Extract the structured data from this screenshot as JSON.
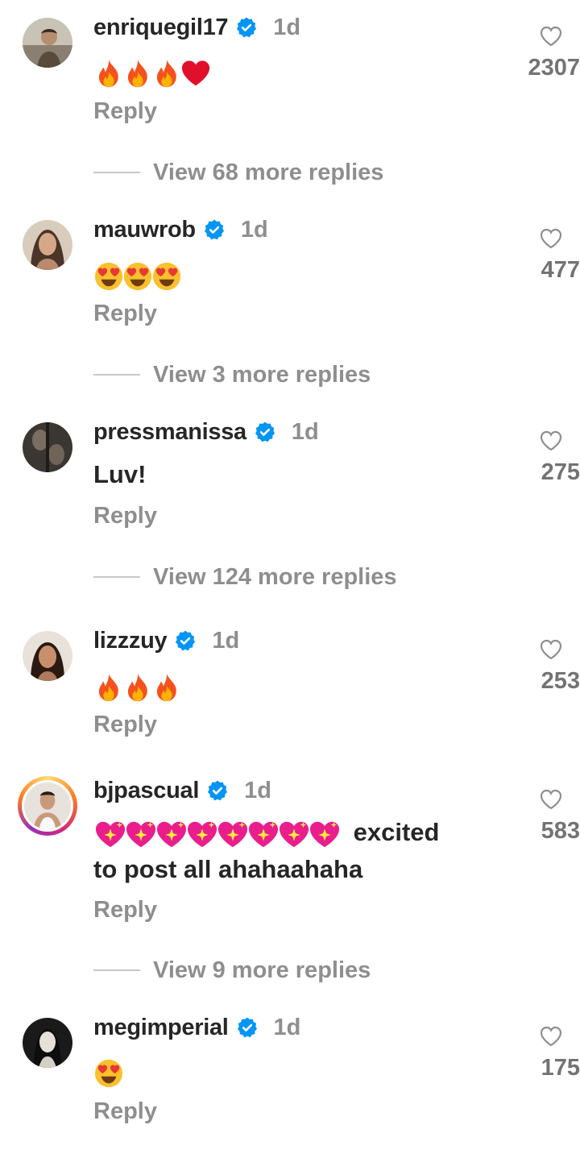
{
  "comments": [
    {
      "username": "enriquegil17",
      "time": "1d",
      "text": "",
      "emojis": [
        "fire",
        "fire",
        "fire",
        "red-heart"
      ],
      "likes": "2307",
      "reply_label": "Reply",
      "more_replies": "View 68 more replies"
    },
    {
      "username": "mauwrob",
      "time": "1d",
      "text": "",
      "emojis": [
        "heart-eyes",
        "heart-eyes",
        "heart-eyes"
      ],
      "likes": "477",
      "reply_label": "Reply",
      "more_replies": "View 3 more replies"
    },
    {
      "username": "pressmanissa",
      "time": "1d",
      "text": "Luv!",
      "emojis": [],
      "likes": "275",
      "reply_label": "Reply",
      "more_replies": "View 124 more replies"
    },
    {
      "username": "lizzzuy",
      "time": "1d",
      "text": "",
      "emojis": [
        "fire",
        "fire",
        "fire"
      ],
      "likes": "253",
      "reply_label": "Reply",
      "more_replies": ""
    },
    {
      "username": "bjpascual",
      "time": "1d",
      "text_after_emojis": "excited",
      "text_line2": "to post all ahahaahaha",
      "emojis": [
        "sparkling-heart",
        "sparkling-heart",
        "sparkling-heart",
        "sparkling-heart",
        "sparkling-heart",
        "sparkling-heart",
        "sparkling-heart",
        "sparkling-heart"
      ],
      "likes": "583",
      "reply_label": "Reply",
      "more_replies": "View 9 more replies"
    },
    {
      "username": "megimperial",
      "time": "1d",
      "text": "",
      "emojis": [
        "heart-eyes"
      ],
      "likes": "175",
      "reply_label": "Reply",
      "more_replies": ""
    }
  ],
  "icons": {
    "verified": "verified-badge-icon",
    "like": "heart-outline-icon"
  },
  "colors": {
    "verified": "#0095f6",
    "username": "#262626",
    "secondary": "#8e8e8e"
  }
}
